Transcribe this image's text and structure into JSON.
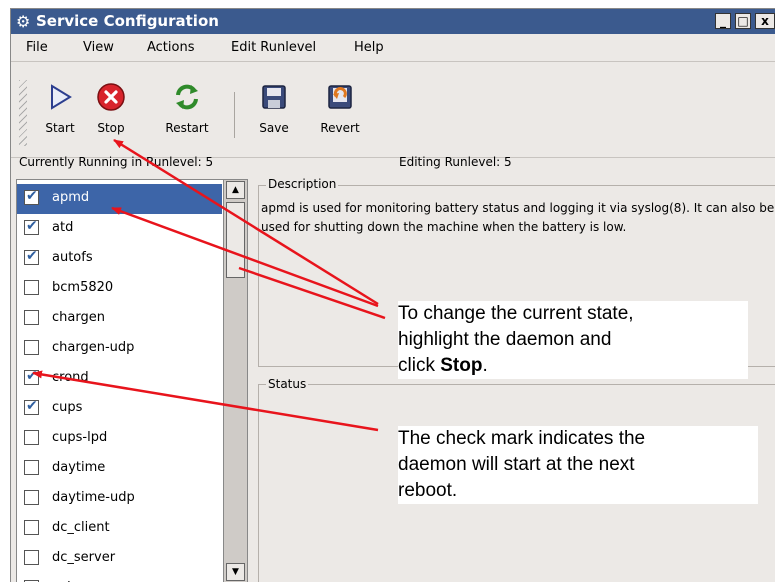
{
  "window": {
    "title": "Service Configuration",
    "buttons": [
      "_",
      "□",
      "x"
    ]
  },
  "menus": [
    "File",
    "View",
    "Actions",
    "Edit Runlevel",
    "Help"
  ],
  "toolbar": {
    "start": "Start",
    "stop": "Stop",
    "restart": "Restart",
    "save": "Save",
    "revert": "Revert"
  },
  "status_line": {
    "running": "Currently Running in Runlevel: 5",
    "editing": "Editing Runlevel: 5"
  },
  "services": [
    {
      "name": "apmd",
      "checked": true,
      "selected": true
    },
    {
      "name": "atd",
      "checked": true
    },
    {
      "name": "autofs",
      "checked": true
    },
    {
      "name": "bcm5820",
      "checked": false
    },
    {
      "name": "chargen",
      "checked": false
    },
    {
      "name": "chargen-udp",
      "checked": false
    },
    {
      "name": "crond",
      "checked": true
    },
    {
      "name": "cups",
      "checked": true
    },
    {
      "name": "cups-lpd",
      "checked": false
    },
    {
      "name": "daytime",
      "checked": false
    },
    {
      "name": "daytime-udp",
      "checked": false
    },
    {
      "name": "dc_client",
      "checked": false
    },
    {
      "name": "dc_server",
      "checked": false
    },
    {
      "name": "echo",
      "checked": false
    }
  ],
  "description": {
    "legend": "Description",
    "text": "apmd is used for monitoring battery status and logging it via syslog(8). It can also be used for shutting down the machine when the battery is low."
  },
  "status": {
    "legend": "Status"
  },
  "callouts": {
    "stop_line1": "To change the current state,",
    "stop_line2": "highlight the daemon and",
    "stop_line3_prefix": "click ",
    "stop_line3_bold": "Stop",
    "stop_line3_suffix": ".",
    "check_line1": "The check mark indicates the",
    "check_line2": "daemon will start at the next",
    "check_line3": "reboot."
  },
  "colors": {
    "titlebar": "#3b5a8e",
    "selection": "#3d65a8",
    "arrow": "#e8141c",
    "stop_icon": "#d8242c"
  }
}
